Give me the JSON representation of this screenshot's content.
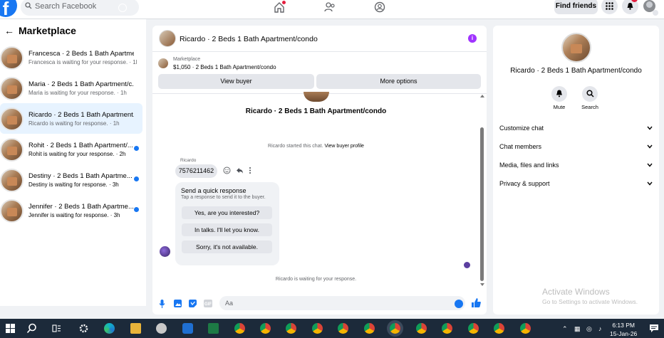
{
  "topbar": {
    "logo": "f",
    "search_placeholder": "Search Facebook",
    "find_friends": "Find friends"
  },
  "marketplace": {
    "title": "Marketplace",
    "conversations": [
      {
        "name": "Francesca · 2 Beds 1 Bath Apartme...",
        "status": "Francesca is waiting for your response. · 1h",
        "selected": false,
        "unread": false
      },
      {
        "name": "Maria · 2 Beds 1 Bath Apartment/c...",
        "status": "Maria is waiting for your response. · 1h",
        "selected": false,
        "unread": false
      },
      {
        "name": "Ricardo · 2 Beds 1 Bath Apartment...",
        "status": "Ricardo is waiting for response. · 1h",
        "selected": true,
        "unread": false
      },
      {
        "name": "Rohit · 2 Beds 1 Bath Apartment/...",
        "status": "Rohit is waiting for your response. · 2h",
        "selected": false,
        "unread": true
      },
      {
        "name": "Destiny · 2 Beds 1 Bath Apartme...",
        "status": "Destiny is waiting for response. · 3h",
        "selected": false,
        "unread": true
      },
      {
        "name": "Jennifer · 2 Beds 1 Bath Apartme...",
        "status": "Jennifer is waiting for response. · 3h",
        "selected": false,
        "unread": true
      }
    ]
  },
  "chat": {
    "title": "Ricardo · 2 Beds 1 Bath Apartment/condo",
    "listing_label": "Marketplace",
    "listing_price": "$1,050 · 2 Beds 1 Bath Apartment/condo",
    "view_buyer": "View buyer",
    "more_options": "More options",
    "center_title": "Ricardo · 2 Beds 1 Bath Apartment/condo",
    "started_text": "Ricardo started this chat.",
    "view_profile": "View buyer profile",
    "sender": "Ricardo",
    "phone": "7576211462",
    "quick_title": "Send a quick response",
    "quick_sub": "Tap a response to send it to the buyer.",
    "quick_options": [
      "Yes, are you interested?",
      "In talks. I'll let you know.",
      "Sorry, it's not available."
    ],
    "waiting": "Ricardo is waiting for your response.",
    "composer_placeholder": "Aa"
  },
  "profile": {
    "name": "Ricardo · 2 Beds 1 Bath Apartment/condo",
    "mute": "Mute",
    "search": "Search",
    "sections": [
      "Customize chat",
      "Chat members",
      "Media, files and links",
      "Privacy & support"
    ]
  },
  "watermark": {
    "line1": "Activate Windows",
    "line2": "Go to Settings to activate Windows."
  },
  "taskbar": {
    "time": "6:13 PM",
    "date": "15-Jan-26"
  },
  "colors": {
    "accent": "#1877f2",
    "selected_bg": "#e7f3ff",
    "taskbar": "#1c2a3a"
  }
}
